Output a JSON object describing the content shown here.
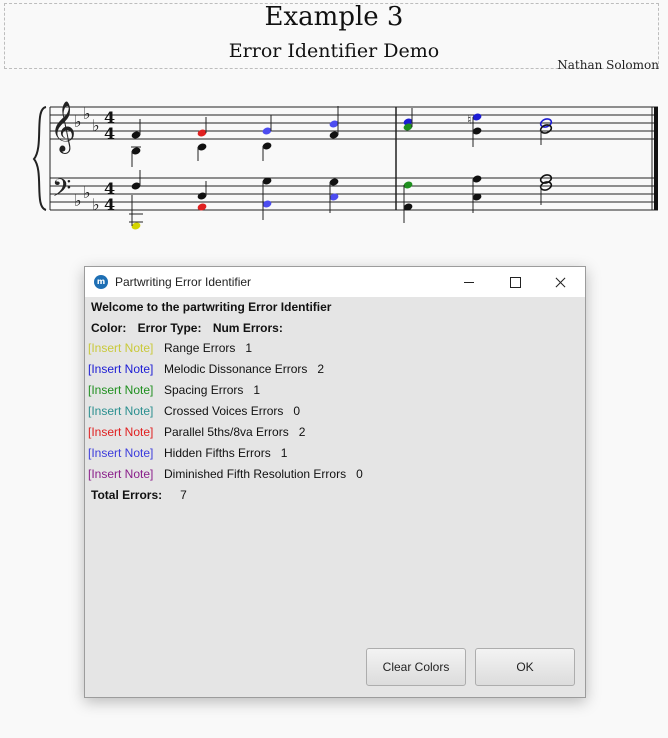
{
  "score": {
    "title": "Example 3",
    "subtitle": "Error Identifier Demo",
    "composer": "Nathan Solomon"
  },
  "dialog": {
    "window_title": "Partwriting Error Identifier",
    "welcome": "Welcome to the partwriting Error Identifier",
    "header_color": "Color:",
    "header_type": "Error Type:",
    "header_num": "Num Errors:",
    "link_text": "[Insert Note]",
    "rows": [
      {
        "type": "Range Errors",
        "count": "1",
        "color": "#c9c93a"
      },
      {
        "type": "Melodic Dissonance Errors",
        "count": "2",
        "color": "#1c1cd4"
      },
      {
        "type": "Spacing Errors",
        "count": "1",
        "color": "#1f8f1f"
      },
      {
        "type": "Crossed Voices Errors",
        "count": "0",
        "color": "#2a8f8f"
      },
      {
        "type": "Parallel 5ths/8va Errors",
        "count": "2",
        "color": "#e02020"
      },
      {
        "type": "Hidden Fifths Errors",
        "count": "1",
        "color": "#3c3cdc"
      },
      {
        "type": "Diminished Fifth Resolution Errors",
        "count": "0",
        "color": "#8a1f8a"
      }
    ],
    "total_label": "Total Errors:",
    "total_value": "7",
    "clear_button": "Clear Colors",
    "ok_button": "OK"
  }
}
